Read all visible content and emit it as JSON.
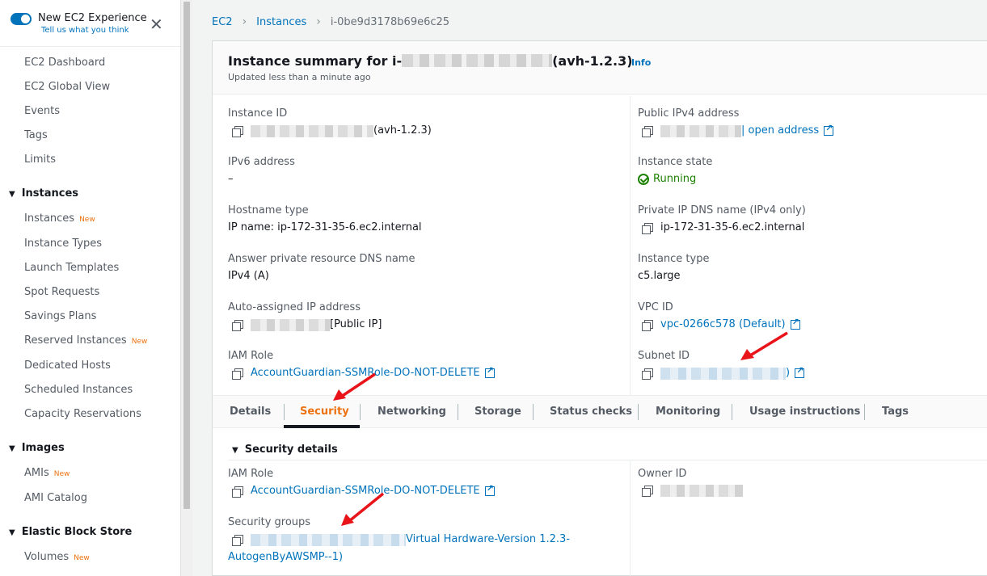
{
  "sidebar": {
    "experience_title": "New EC2 Experience",
    "experience_link": "Tell us what you think",
    "close_glyph": "✕",
    "top_items": [
      "EC2 Dashboard",
      "EC2 Global View",
      "Events",
      "Tags",
      "Limits"
    ],
    "sections": {
      "instances": "Instances",
      "images": "Images",
      "ebs": "Elastic Block Store"
    },
    "instances_items": [
      "Instances",
      "Instance Types",
      "Launch Templates",
      "Spot Requests",
      "Savings Plans",
      "Reserved Instances",
      "Dedicated Hosts",
      "Scheduled Instances",
      "Capacity Reservations"
    ],
    "images_items": [
      "AMIs",
      "AMI Catalog"
    ],
    "ebs_items": [
      "Volumes"
    ],
    "new_badge": "New"
  },
  "breadcrumb": {
    "ec2": "EC2",
    "instances": "Instances",
    "current": "i-0be9d3178b69e6c25"
  },
  "summary": {
    "title_prefix": "Instance summary for i-",
    "title_suffix": "(avh-1.2.3)",
    "info": "Info",
    "updated": "Updated less than a minute ago"
  },
  "fields": {
    "instance_id_label": "Instance ID",
    "instance_id_suffix": "(avh-1.2.3)",
    "public_ipv4_label": "Public IPv4 address",
    "open_address": "| open address",
    "ipv6_label": "IPv6 address",
    "ipv6_value": "–",
    "state_label": "Instance state",
    "state_value": "Running",
    "hostname_label": "Hostname type",
    "hostname_value": "IP name: ip-172-31-35-6.ec2.internal",
    "private_dns_label": "Private IP DNS name (IPv4 only)",
    "private_dns_value": "ip-172-31-35-6.ec2.internal",
    "answer_dns_label": "Answer private resource DNS name",
    "answer_dns_value": "IPv4 (A)",
    "instance_type_label": "Instance type",
    "instance_type_value": "c5.large",
    "auto_ip_label": "Auto-assigned IP address",
    "auto_ip_suffix": "[Public IP]",
    "vpc_label": "VPC ID",
    "vpc_value": "vpc-0266c578 (Default)",
    "iam_label": "IAM Role",
    "iam_value": "AccountGuardian-SSMRole-DO-NOT-DELETE",
    "subnet_label": "Subnet ID",
    "subnet_suffix": ")"
  },
  "tabs": [
    "Details",
    "Security",
    "Networking",
    "Storage",
    "Status checks",
    "Monitoring",
    "Usage instructions",
    "Tags"
  ],
  "active_tab": "Security",
  "security": {
    "heading": "Security details",
    "iam_label": "IAM Role",
    "iam_value": "AccountGuardian-SSMRole-DO-NOT-DELETE",
    "owner_label": "Owner ID",
    "sg_label": "Security groups",
    "sg_value_line1": "Virtual Hardware-Version 1.2.3-",
    "sg_value_line2": "AutogenByAWSMP--1)"
  },
  "colors": {
    "accent": "#ec7211",
    "link": "#0073bb",
    "success": "#1d8102",
    "annotation_arrow": "#e8141a"
  }
}
